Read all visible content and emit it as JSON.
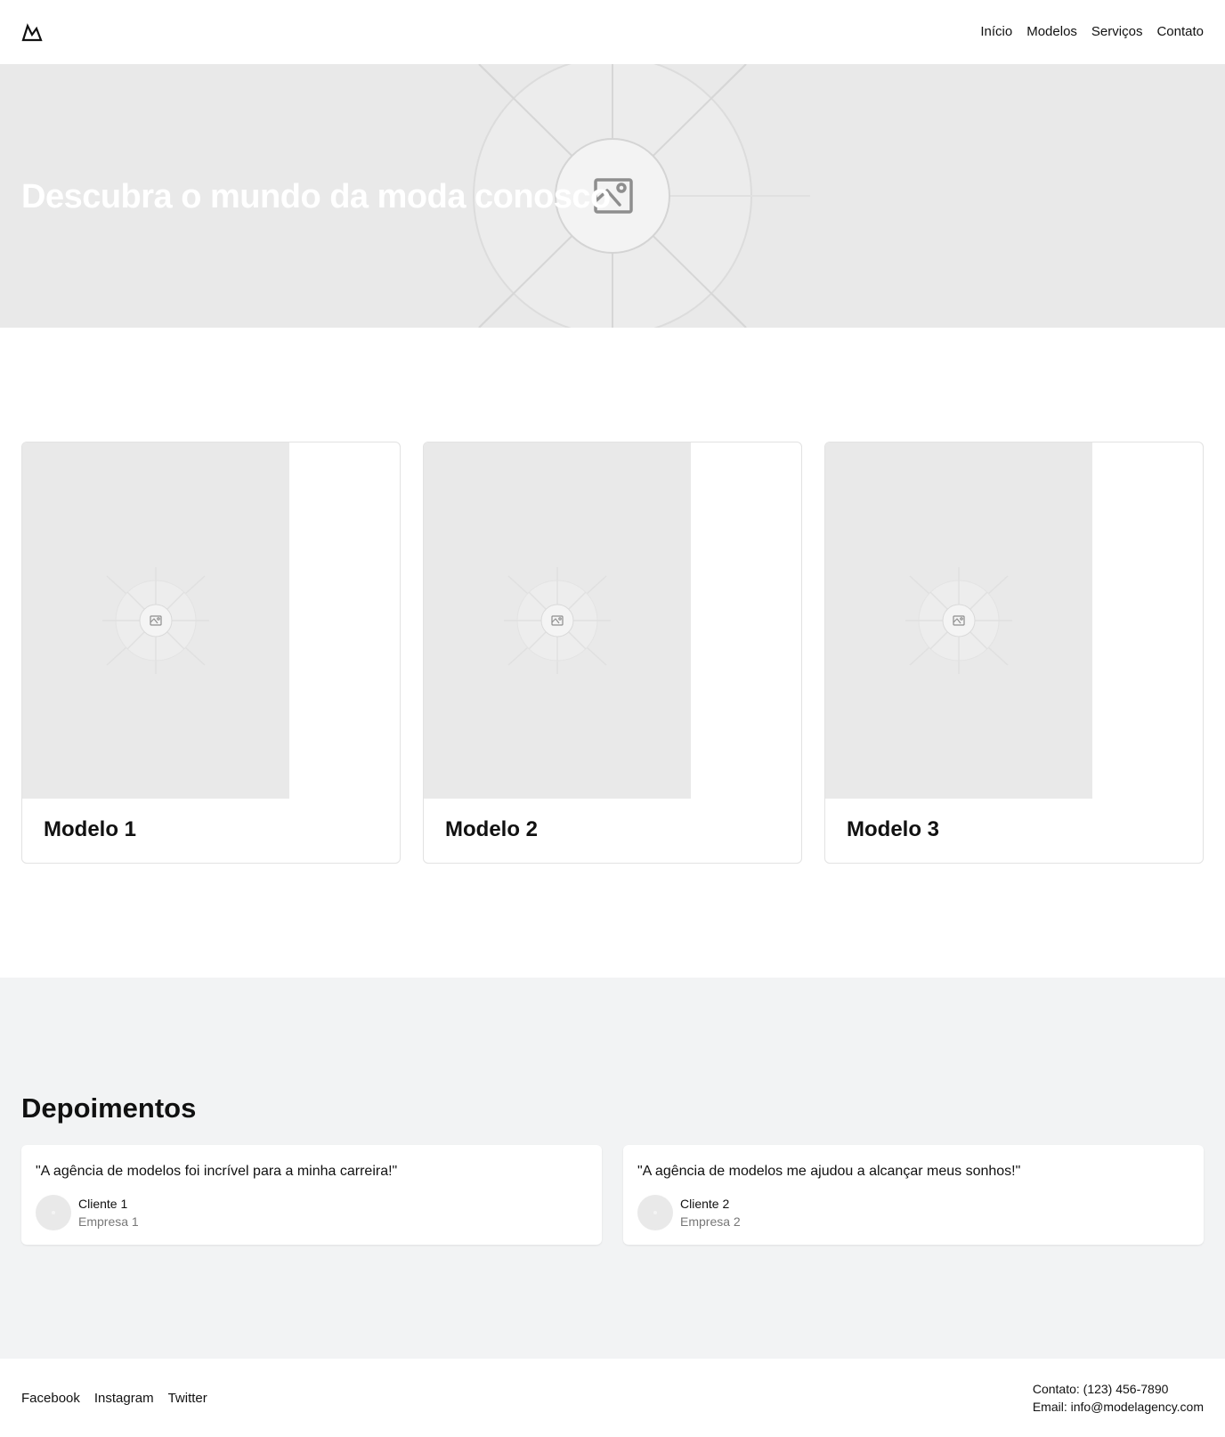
{
  "header": {
    "logo_icon": "mountain-logo-icon",
    "nav": [
      {
        "label": "Início"
      },
      {
        "label": "Modelos"
      },
      {
        "label": "Serviços"
      },
      {
        "label": "Contato"
      }
    ]
  },
  "hero": {
    "title": "Descubra o mundo da moda conosco",
    "image_icon": "image-placeholder-icon"
  },
  "models": [
    {
      "name": "Modelo 1",
      "image_icon": "image-placeholder-icon"
    },
    {
      "name": "Modelo 2",
      "image_icon": "image-placeholder-icon"
    },
    {
      "name": "Modelo 3",
      "image_icon": "image-placeholder-icon"
    }
  ],
  "testimonials": {
    "title": "Depoimentos",
    "items": [
      {
        "quote": "\"A agência de modelos foi incrível para a minha carreira!\"",
        "client": "Cliente 1",
        "company": "Empresa 1"
      },
      {
        "quote": "\"A agência de modelos me ajudou a alcançar meus sonhos!\"",
        "client": "Cliente 2",
        "company": "Empresa 2"
      }
    ]
  },
  "footer": {
    "social": [
      {
        "label": "Facebook"
      },
      {
        "label": "Instagram"
      },
      {
        "label": "Twitter"
      }
    ],
    "contact_phone": "Contato: (123) 456-7890",
    "contact_email": "Email: info@modelagency.com"
  },
  "colors": {
    "placeholder_bg": "#e9e9e9",
    "section_bg": "#f2f3f4",
    "text": "#111111",
    "muted": "#777777"
  }
}
